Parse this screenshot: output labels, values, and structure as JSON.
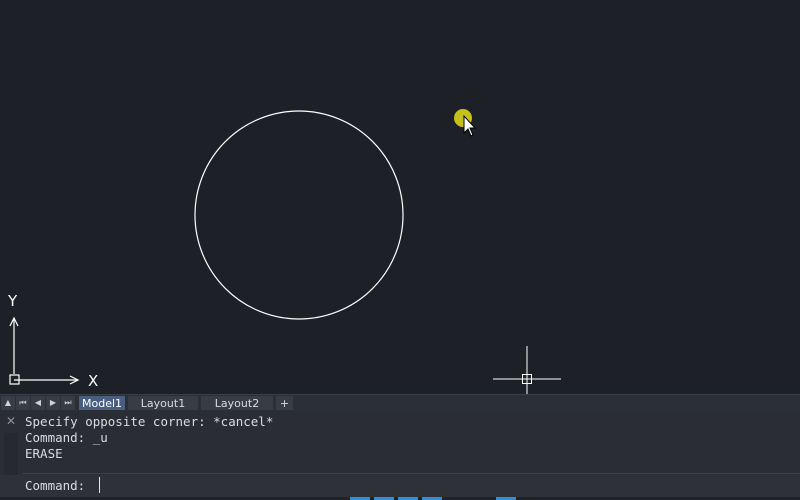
{
  "canvas": {
    "background": "#1d2026",
    "entity_color": "#ffffff",
    "ucs_x_label": "X",
    "ucs_y_label": "Y",
    "cursor_highlight_color": "#d9d21a"
  },
  "layout_tabs": {
    "nav_icons": [
      "eject-icon",
      "first-icon",
      "prev-icon",
      "next-icon",
      "last-icon"
    ],
    "nav_glyphs": [
      "▲",
      "⏮",
      "◀",
      "▶",
      "⏭"
    ],
    "tabs": [
      {
        "label": "Model1",
        "active": true
      },
      {
        "label": "Layout1",
        "active": false
      },
      {
        "label": "Layout2",
        "active": false
      }
    ],
    "add_label": "+"
  },
  "command_line": {
    "close_glyph": "✕",
    "history": [
      "Specify opposite corner: *cancel*",
      "Command: _u",
      "ERASE"
    ],
    "prompt": "Command:",
    "input_value": ""
  }
}
